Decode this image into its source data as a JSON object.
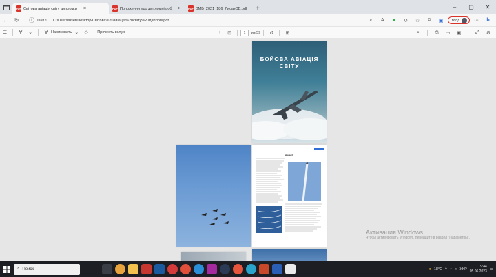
{
  "tabs": [
    {
      "label": "Світова авіація світу диплом.p",
      "active": true
    },
    {
      "label": "Положення про дипломні роб",
      "active": false
    },
    {
      "label": "ВМБ_2021_186_ЛисакОВ.pdf",
      "active": false
    }
  ],
  "address": {
    "label": "Файл",
    "url": "C:/Users/user/Desktop/Світова%20авіація%20світу%20диплом.pdf",
    "signin": "Вход"
  },
  "pdf_toolbar": {
    "draw_label": "Нарисовать",
    "read_label": "Прочесть вслух",
    "page_number": "1",
    "page_total": "из 59"
  },
  "document": {
    "cover_title_line1": "БОЙОВА АВІАЦІЯ",
    "cover_title_line2": "СВІТУ",
    "toc_heading": "ЗМІСТ"
  },
  "watermark": {
    "title": "Активация Windows",
    "subtitle": "Чтобы активировать Windows, перейдите в раздел \"Параметры\"."
  },
  "taskbar": {
    "search_placeholder": "Поиск",
    "weather": "18°C",
    "lang": "УКР",
    "time": "9:44",
    "date": "05.06.2023"
  },
  "colors": {
    "pdf_red": "#d9342b",
    "taskbar": "#1c1e24"
  }
}
